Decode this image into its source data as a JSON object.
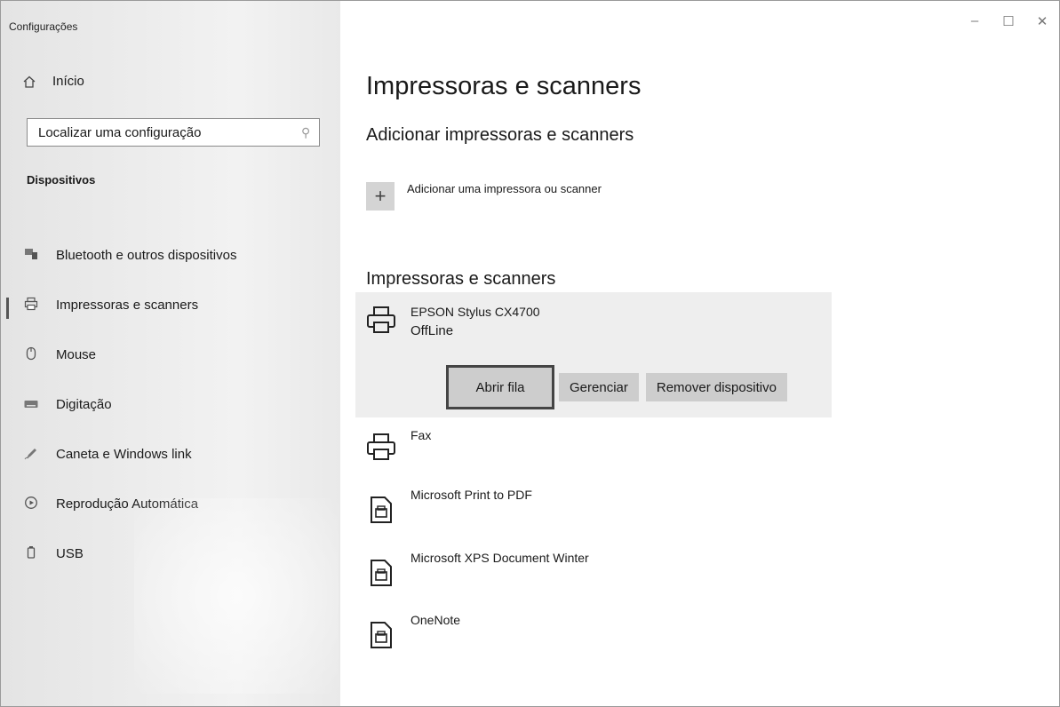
{
  "window": {
    "title": "Configurações",
    "controls": [
      "–",
      "☐",
      "✕"
    ]
  },
  "sidebar": {
    "home_label": "Início",
    "search_placeholder": "Localizar uma configuração",
    "section_title": "Dispositivos",
    "items": [
      {
        "label": "Bluetooth e outros dispositivos",
        "icon": "bluetooth-devices-icon"
      },
      {
        "label": "Impressoras e scanners",
        "icon": "printer-icon",
        "active": true
      },
      {
        "label": "Mouse",
        "icon": "mouse-icon"
      },
      {
        "label": "Digitação",
        "icon": "keyboard-icon"
      },
      {
        "label": "Caneta e Windows link",
        "icon": "pen-icon"
      },
      {
        "label": "Reprodução Automática",
        "icon": "autoplay-icon"
      },
      {
        "label": "USB",
        "icon": "usb-icon"
      }
    ]
  },
  "main": {
    "title": "Impressoras e scanners",
    "add_section_title": "Adicionar impressoras e scanners",
    "add_button_label": "Adicionar uma impressora ou scanner",
    "list_title": "Impressoras e scanners",
    "devices": [
      {
        "name": "EPSON Stylus CX4700",
        "status": "OffLine",
        "icon": "printer-icon",
        "selected": true
      },
      {
        "name": "Fax",
        "icon": "printer-icon"
      },
      {
        "name": "Microsoft Print to PDF",
        "icon": "document-printer-icon"
      },
      {
        "name": "Microsoft XPS Document Winter",
        "icon": "document-printer-icon"
      },
      {
        "name": "OneNote",
        "icon": "document-printer-icon"
      }
    ],
    "actions": {
      "open_queue": "Abrir fila",
      "manage": "Gerenciar",
      "remove": "Remover dispositivo"
    }
  }
}
